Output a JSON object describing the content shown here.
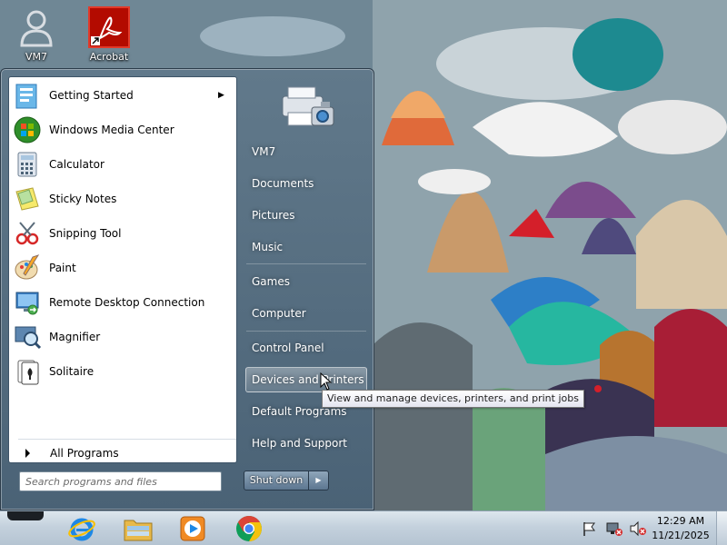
{
  "desktop": {
    "icons": [
      {
        "label": "VM7"
      },
      {
        "label": "Acrobat"
      }
    ]
  },
  "start_menu": {
    "programs": [
      {
        "label": "Getting Started",
        "icon": "getting-started-icon",
        "has_submenu": true
      },
      {
        "label": "Windows Media Center",
        "icon": "windows-media-center-icon"
      },
      {
        "label": "Calculator",
        "icon": "calculator-icon"
      },
      {
        "label": "Sticky Notes",
        "icon": "sticky-notes-icon"
      },
      {
        "label": "Snipping Tool",
        "icon": "snipping-tool-icon"
      },
      {
        "label": "Paint",
        "icon": "paint-icon"
      },
      {
        "label": "Remote Desktop Connection",
        "icon": "remote-desktop-icon"
      },
      {
        "label": "Magnifier",
        "icon": "magnifier-icon"
      },
      {
        "label": "Solitaire",
        "icon": "solitaire-icon"
      }
    ],
    "all_programs": "All Programs",
    "search_placeholder": "Search programs and files",
    "right_items": [
      {
        "label": "VM7"
      },
      {
        "label": "Documents"
      },
      {
        "label": "Pictures"
      },
      {
        "label": "Music"
      },
      {
        "label": "Games"
      },
      {
        "label": "Computer"
      },
      {
        "label": "Control Panel"
      },
      {
        "label": "Devices and Printers",
        "hovered": true
      },
      {
        "label": "Default Programs"
      },
      {
        "label": "Help and Support"
      }
    ],
    "shutdown_label": "Shut down",
    "tooltip": "View and manage devices, printers, and print jobs"
  },
  "taskbar": {
    "pinned": [
      {
        "icon": "internet-explorer-icon"
      },
      {
        "icon": "windows-explorer-icon"
      },
      {
        "icon": "windows-media-player-icon"
      },
      {
        "icon": "chrome-icon"
      }
    ],
    "tray_icons": [
      "action-center-flag-icon",
      "network-icon",
      "volume-muted-icon"
    ],
    "clock": {
      "time": "12:29 AM",
      "date": "11/21/2025"
    }
  },
  "colors": {
    "accent": "#4a6a84",
    "chrome_red": "#db4437",
    "chrome_yellow": "#f4c20d",
    "chrome_green": "#0f9d58",
    "chrome_blue": "#4285f4"
  }
}
